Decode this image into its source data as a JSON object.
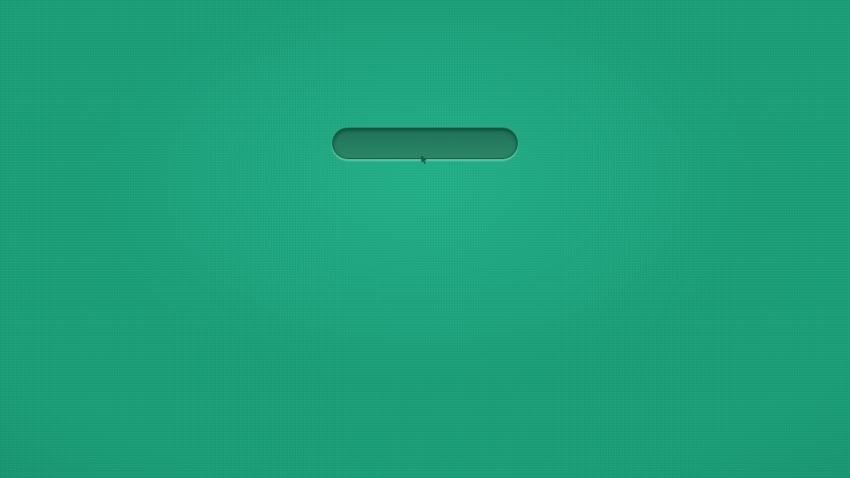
{
  "login_form": {
    "text_input": {
      "value": "",
      "placeholder": ""
    }
  },
  "pointer": {
    "icon": "mouse-pointer-icon"
  },
  "colors": {
    "background": "#1a9e78",
    "input_fill": "#2a7f63",
    "input_highlight": "#c8ffeb"
  }
}
